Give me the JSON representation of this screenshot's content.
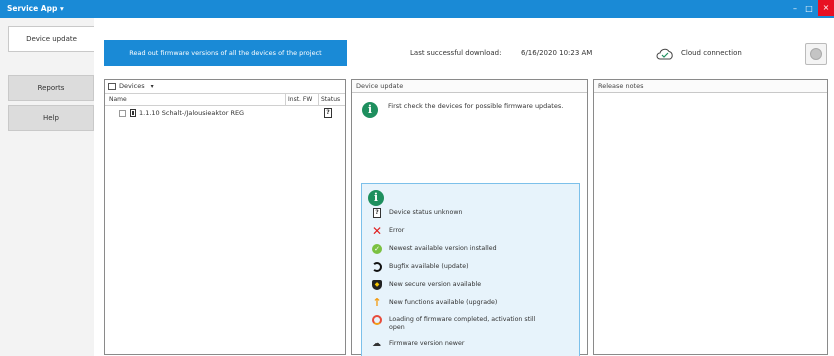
{
  "window": {
    "title": "Service App",
    "title_caret": "▾",
    "minimize": "–",
    "maximize": "□",
    "close": "×"
  },
  "nav": {
    "tabs": [
      {
        "label": "Device update",
        "active": true
      },
      {
        "label": "Reports",
        "active": false
      },
      {
        "label": "Help",
        "active": false
      }
    ]
  },
  "toolbar": {
    "read_button": "Read out firmware versions of all the devices of the project",
    "last_download_label": "Last successful download:",
    "last_download_value": "6/16/2020 10:23 AM",
    "cloud_label": "Cloud connection"
  },
  "devices_panel": {
    "filter_label": "Devices",
    "filter_caret": "▾",
    "columns": {
      "name": "Name",
      "inst_fw": "Inst. FW",
      "status": "Status"
    },
    "rows": [
      {
        "name": "1.1.10 Schalt-/Jalousieaktor REG",
        "status_icon": "?"
      }
    ]
  },
  "update_panel": {
    "header": "Device update",
    "message": "First check the devices for possible firmware updates.",
    "info_glyph": "i",
    "legend": [
      {
        "icon": "device-status-unknown-icon",
        "glyph": "?",
        "text": "Device status unknown"
      },
      {
        "icon": "error-icon",
        "glyph": "✕",
        "text": "Error"
      },
      {
        "icon": "newest-version-icon",
        "glyph": "✓",
        "text": "Newest available version installed"
      },
      {
        "icon": "bugfix-icon",
        "glyph": "",
        "text": "Bugfix available (update)"
      },
      {
        "icon": "secure-version-icon",
        "glyph": "◆",
        "text": "New secure version available"
      },
      {
        "icon": "new-functions-icon",
        "glyph": "↑",
        "text": "New functions available (upgrade)"
      },
      {
        "icon": "loading-completed-icon",
        "glyph": "",
        "text": "Loading of firmware completed, activation still open"
      },
      {
        "icon": "firmware-newer-icon",
        "glyph": "☁",
        "text": "Firmware version newer"
      }
    ]
  },
  "notes_panel": {
    "header": "Release notes"
  },
  "colors": {
    "accent": "#1a8ad6",
    "info_green": "#1e8f5e",
    "legend_bg": "#e7f3fb",
    "error_red": "#e02020"
  }
}
